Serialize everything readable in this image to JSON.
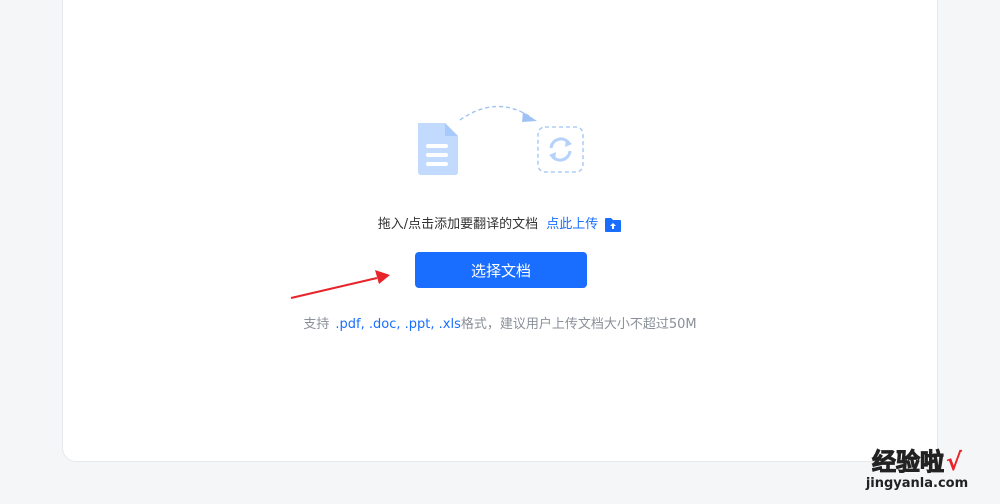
{
  "upload_panel": {
    "hint_text": "拖入/点击添加要翻译的文档",
    "upload_link_label": "点此上传",
    "select_button_label": "选择文档",
    "format_prefix": "支持",
    "format_list": ".pdf, .doc, .ppt, .xls",
    "format_suffix": "格式，建议用户上传文档大小不超过50M"
  },
  "watermark": {
    "title": "经验啦",
    "check": "√",
    "url": "jingyanla.com"
  },
  "icons": {
    "document": "document-icon",
    "convert": "convert-refresh-icon",
    "folder_upload": "folder-upload-icon",
    "annotation_arrow": "red-arrow-annotation"
  },
  "colors": {
    "accent": "#1a6eff",
    "illustration_light": "#c2dafd",
    "illustration_dashed": "#9fc2f5",
    "annotation": "#e8232a",
    "muted_text": "#8a8f99"
  }
}
